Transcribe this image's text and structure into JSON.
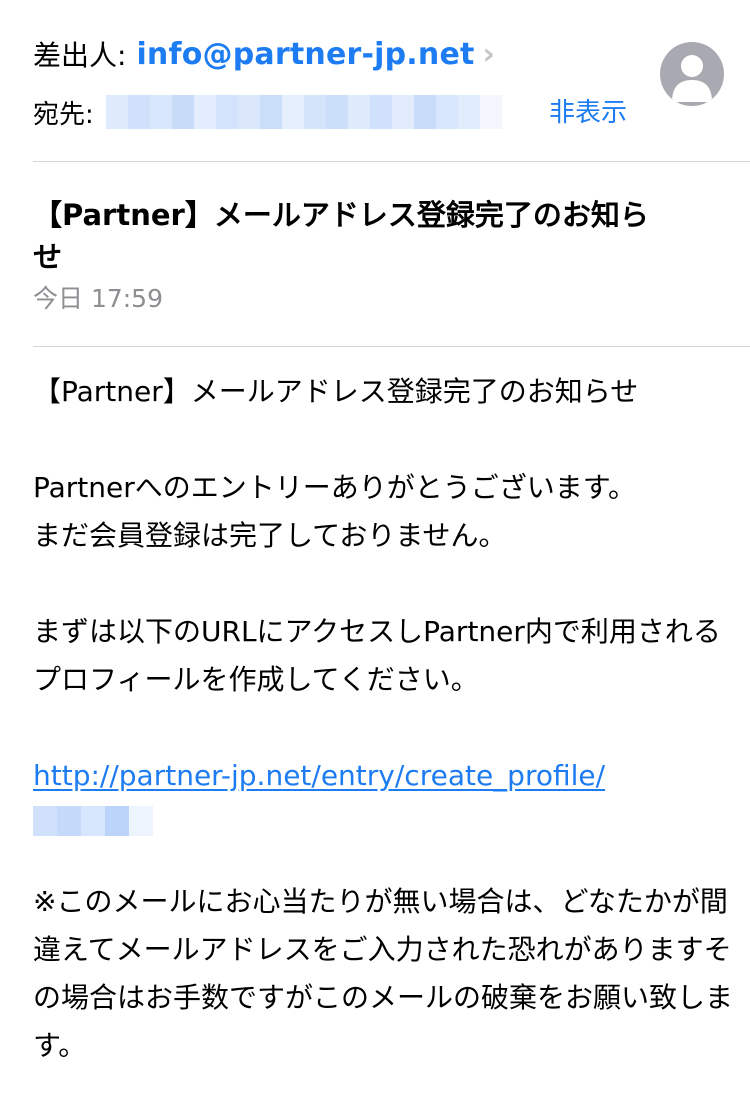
{
  "header": {
    "from_label": "差出人:",
    "sender_email": "info@partner-jp.net",
    "to_label": "宛先:",
    "hide_label": "非表示"
  },
  "message": {
    "subject": "【Partner】メールアドレス登録完了のお知らせ",
    "date": "今日 17:59"
  },
  "body": {
    "heading": "【Partner】メールアドレス登録完了のお知らせ",
    "paragraph1": "Partnerへのエントリーありがとうございます。\nまだ会員登録は完了しておりません。",
    "paragraph2": "まずは以下のURLにアクセスしPartner内で利用されるプロフィールを作成してください。",
    "link_url": "http://partner-jp.net/entry/create_profile/",
    "paragraph3": "※このメールにお心当たりが無い場合は、どなたかが間違えてメールアドレスをご入力された恐れがありますその場合はお手数ですがこのメールの破棄をお願い致します。"
  },
  "colors": {
    "accent": "#1d7cf2",
    "muted": "#8e8e93",
    "divider": "#d6d6d8"
  },
  "icons": {
    "sender_chevron": "chevron-right-icon",
    "avatar": "person-silhouette-icon"
  }
}
